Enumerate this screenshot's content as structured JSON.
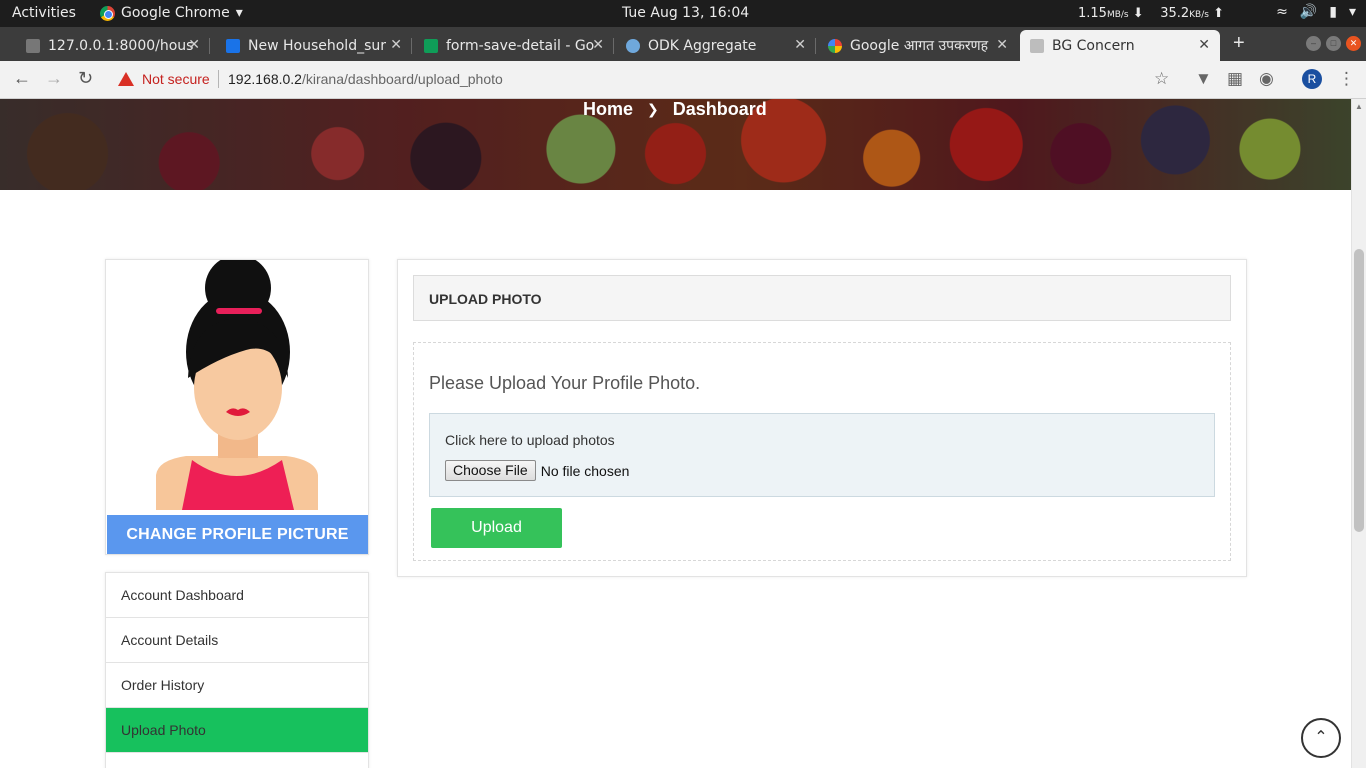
{
  "system": {
    "activities": "Activities",
    "app_name": "Google Chrome",
    "clock": "Tue Aug 13, 16:04",
    "net_down_value": "1.15",
    "net_down_unit": "MB/s",
    "net_up_value": "35.2",
    "net_up_unit": "KB/s"
  },
  "tabs": [
    {
      "title": "127.0.0.1:8000/hous",
      "favicon_color": "#777777"
    },
    {
      "title": "New Household_sur",
      "favicon_color": "#1a73e8"
    },
    {
      "title": "form-save-detail - Go",
      "favicon_color": "#0f9d58"
    },
    {
      "title": "ODK Aggregate",
      "favicon_color": "#6fa8dc"
    },
    {
      "title": "Google आगत उपकरणह",
      "favicon_color": "#4285f4"
    },
    {
      "title": "BG Concern",
      "favicon_color": "#888888"
    }
  ],
  "addressbar": {
    "security_label": "Not secure",
    "url_host": "192.168.0.2",
    "url_path": "/kirana/dashboard/upload_photo",
    "profile_initial": "R"
  },
  "page": {
    "breadcrumb": {
      "home": "Home",
      "current": "Dashboard"
    },
    "profile": {
      "change_picture_label": "CHANGE PROFILE PICTURE"
    },
    "menu": [
      {
        "label": "Account Dashboard"
      },
      {
        "label": "Account Details"
      },
      {
        "label": "Order History"
      },
      {
        "label": "Upload Photo"
      }
    ],
    "upload": {
      "heading": "UPLOAD PHOTO",
      "lead": "Please Upload Your Profile Photo.",
      "dropzone_label": "Click here to upload photos",
      "choose_file_label": "Choose File",
      "file_status": "No file chosen",
      "submit_label": "Upload"
    }
  },
  "colors": {
    "accent_blue": "#5a97ee",
    "active_menu": "#17c15d",
    "upload_button": "#35c25a",
    "insecure_red": "#d93025"
  }
}
